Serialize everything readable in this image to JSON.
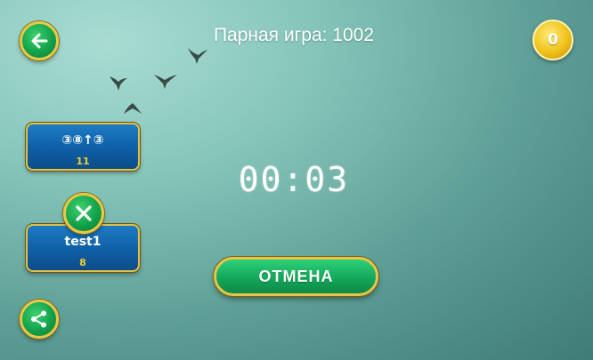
{
  "header": {
    "title": "Парная игра: 1002",
    "coins": "0"
  },
  "cards": [
    {
      "name": "③⑧↑③",
      "score": "11"
    },
    {
      "name": "test1",
      "score": "8"
    }
  ],
  "timer": "00:03",
  "cancel_label": "ОТМЕНА",
  "icons": {
    "back": "arrow-left-icon",
    "remove": "close-icon",
    "share": "share-icon",
    "coin": "coin-icon"
  },
  "colors": {
    "button_green": "#12a24a",
    "card_blue": "#0f5fa5",
    "gold_border": "#e2c04a",
    "score_yellow": "#f3cf2e"
  }
}
